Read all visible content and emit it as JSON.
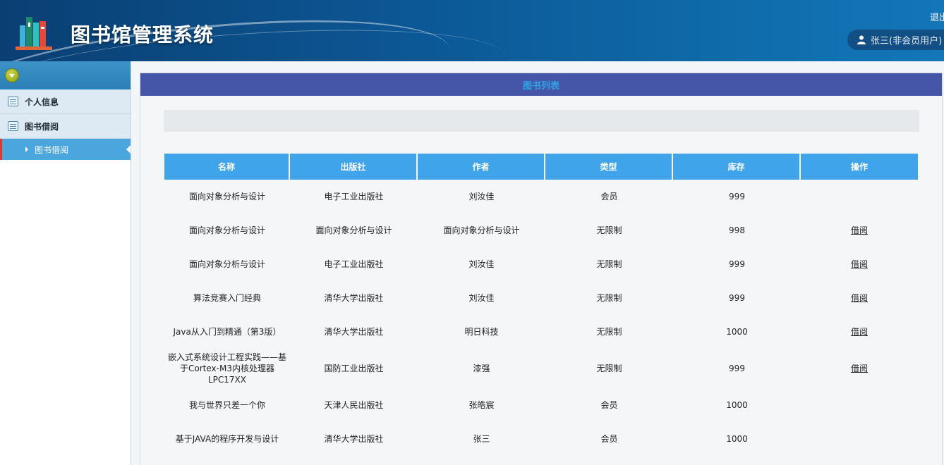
{
  "header": {
    "title": "图书馆管理系统",
    "logout_label": "退出",
    "user_label": "张三(非会员用户)",
    "logo_icon": "books-logo-icon",
    "user_icon": "user-icon"
  },
  "sidebar": {
    "toggle_icon": "chevron-down-icon",
    "items": [
      {
        "label": "个人信息",
        "icon": "list-icon"
      },
      {
        "label": "图书借阅",
        "icon": "list-icon"
      }
    ],
    "active_sub_item": {
      "label": "图书借阅"
    }
  },
  "panel": {
    "title": "图书列表"
  },
  "table": {
    "columns": [
      "名称",
      "出版社",
      "作者",
      "类型",
      "库存",
      "操作"
    ],
    "rows": [
      {
        "name": "面向对象分析与设计",
        "publisher": "电子工业出版社",
        "author": "刘汝佳",
        "type": "会员",
        "stock": "999",
        "action": ""
      },
      {
        "name": "面向对象分析与设计",
        "publisher": "面向对象分析与设计",
        "author": "面向对象分析与设计",
        "type": "无限制",
        "stock": "998",
        "action": "借阅"
      },
      {
        "name": "面向对象分析与设计",
        "publisher": "电子工业出版社",
        "author": "刘汝佳",
        "type": "无限制",
        "stock": "999",
        "action": "借阅"
      },
      {
        "name": "算法竞赛入门经典",
        "publisher": "清华大学出版社",
        "author": "刘汝佳",
        "type": "无限制",
        "stock": "999",
        "action": "借阅"
      },
      {
        "name": "Java从入门到精通（第3版）",
        "publisher": "清华大学出版社",
        "author": "明日科技",
        "type": "无限制",
        "stock": "1000",
        "action": "借阅"
      },
      {
        "name": "嵌入式系统设计工程实践——基于Cortex-M3内核处理器LPC17XX",
        "publisher": "国防工业出版社",
        "author": "漆强",
        "type": "无限制",
        "stock": "999",
        "action": "借阅"
      },
      {
        "name": "我与世界只差一个你",
        "publisher": "天津人民出版社",
        "author": "张皓宸",
        "type": "会员",
        "stock": "1000",
        "action": ""
      },
      {
        "name": "基于JAVA的程序开发与设计",
        "publisher": "清华大学出版社",
        "author": "张三",
        "type": "会员",
        "stock": "1000",
        "action": ""
      }
    ]
  },
  "colors": {
    "header_bg": "#0c5896",
    "panel_head_bg": "#4555a8",
    "panel_head_text": "#2fa3e6",
    "table_head_bg": "#3fa4ea",
    "active_nav_bg": "#4aa6dc",
    "active_nav_marker": "#d93a2b"
  }
}
